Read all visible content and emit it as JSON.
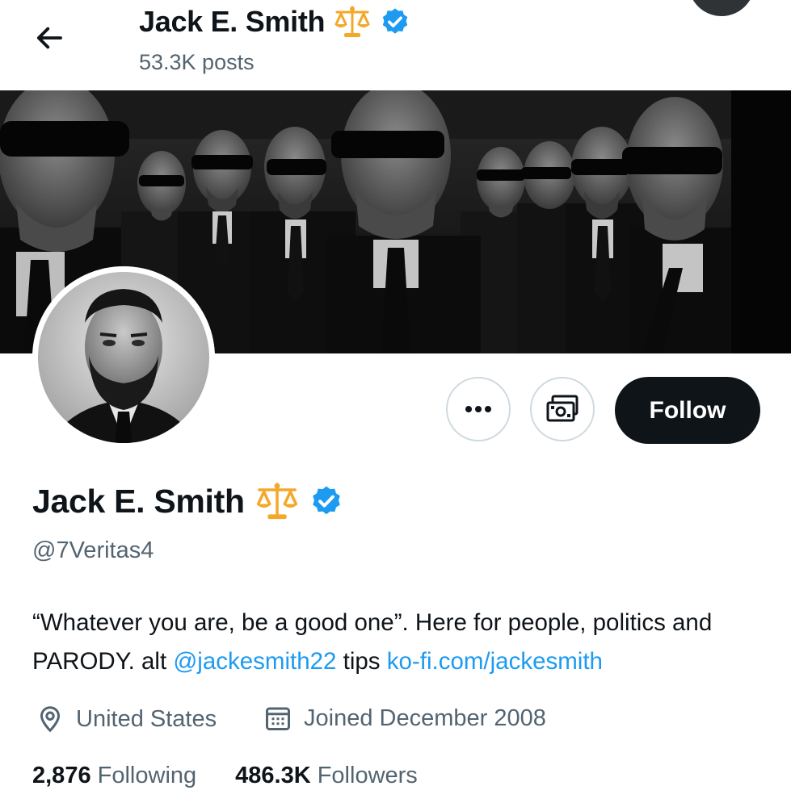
{
  "header": {
    "name": "Jack E. Smith",
    "posts": "53.3K posts",
    "name_emoji": "⚖️"
  },
  "profile": {
    "name": "Jack E. Smith",
    "name_emoji": "⚖️",
    "handle": "@7Veritas4",
    "bio_part1": "“Whatever you are, be a good one”. Here for people, politics and PARODY. alt ",
    "bio_link1": "@jackesmith22",
    "bio_part2": " tips ",
    "bio_link2": "ko-fi.com/jackesmith",
    "location": "United States",
    "joined": "Joined December 2008"
  },
  "stats": {
    "following_count": "2,876",
    "following_label": "Following",
    "followers_count": "486.3K",
    "followers_label": "Followers"
  },
  "buttons": {
    "follow": "Follow",
    "more": "•••"
  },
  "icons": {
    "back": "arrow-left-icon",
    "verified": "verified-badge-icon",
    "more": "more-dots-icon",
    "tips": "money-icon",
    "location": "location-pin-icon",
    "calendar": "calendar-icon"
  },
  "colors": {
    "accent": "#1d9bf0",
    "text": "#0f1419",
    "muted": "#536471",
    "follow_bg": "#0f1419",
    "border": "#cfd9de",
    "emoji_gold": "#f4a82a"
  }
}
